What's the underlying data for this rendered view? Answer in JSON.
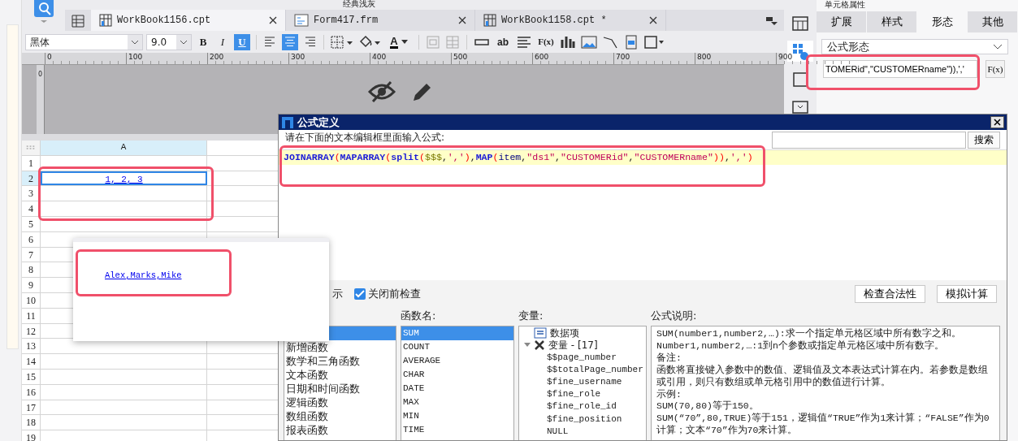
{
  "top_bar": {
    "theme_label": "经典浅灰"
  },
  "tabs": [
    {
      "label": "WorkBook1156.cpt",
      "kind": "report",
      "selected": true
    },
    {
      "label": "Form417.frm",
      "kind": "form",
      "selected": false
    },
    {
      "label": "WorkBook1158.cpt *",
      "kind": "report",
      "selected": false
    }
  ],
  "format_toolbar": {
    "font": "黑体",
    "size": "9.0",
    "style_buttons": [
      {
        "label": "B",
        "on": false
      },
      {
        "label": "I",
        "on": false
      },
      {
        "label": "U",
        "on": true
      }
    ],
    "align_buttons": [
      {
        "kind": "left",
        "selected": false
      },
      {
        "kind": "center",
        "selected": true
      },
      {
        "kind": "right",
        "selected": false
      }
    ],
    "font_color_label": "A",
    "insert_tools": [
      {
        "kind": "field"
      },
      {
        "kind": "text",
        "label": "ab"
      },
      {
        "kind": "lines"
      },
      {
        "kind": "formula",
        "label": "F(x)"
      },
      {
        "kind": "chart"
      },
      {
        "kind": "image"
      },
      {
        "kind": "slash"
      },
      {
        "kind": "doc"
      },
      {
        "kind": "border"
      }
    ]
  },
  "ruler": {
    "ticks": [
      "0",
      "100",
      "200",
      "300",
      "400",
      "500",
      "600",
      "700",
      "800",
      "900"
    ],
    "vertical_tick": "0"
  },
  "sheet": {
    "columns": [
      "A"
    ],
    "rows": [
      {
        "label": "1",
        "selected": false
      },
      {
        "label": "2",
        "selected": true,
        "value": "1, 2, 3"
      },
      {
        "label": "3",
        "selected": false
      },
      {
        "label": "4",
        "selected": false
      },
      {
        "label": "5",
        "selected": false
      },
      {
        "label": "6",
        "selected": false
      },
      {
        "label": "7",
        "selected": false
      },
      {
        "label": "8",
        "selected": false
      },
      {
        "label": "9",
        "selected": false
      },
      {
        "label": "10",
        "selected": false
      },
      {
        "label": "11",
        "selected": false
      },
      {
        "label": "12",
        "selected": false
      },
      {
        "label": "13",
        "selected": false
      },
      {
        "label": "14",
        "selected": false
      },
      {
        "label": "15",
        "selected": false
      },
      {
        "label": "16",
        "selected": false
      },
      {
        "label": "17",
        "selected": false
      },
      {
        "label": "18",
        "selected": false
      },
      {
        "label": "19",
        "selected": false
      }
    ]
  },
  "preview_popup": {
    "text": "Alex,Marks,Mike"
  },
  "dialog": {
    "title": "公式定义",
    "prompt": "请在下面的文本编辑框里面输入公式:",
    "search_button": "搜索",
    "formula": [
      {
        "text": "JOINARRAY",
        "kind": "func"
      },
      {
        "text": "(",
        "kind": "paren"
      },
      {
        "text": "MAPARRAY",
        "kind": "func"
      },
      {
        "text": "(",
        "kind": "paren"
      },
      {
        "text": "split",
        "kind": "func"
      },
      {
        "text": "(",
        "kind": "paren"
      },
      {
        "text": "$$$",
        "kind": "var"
      },
      {
        "text": ",",
        "kind": "punct"
      },
      {
        "text": "','",
        "kind": "string"
      },
      {
        "text": ")",
        "kind": "paren"
      },
      {
        "text": ",",
        "kind": "punct"
      },
      {
        "text": "MAP",
        "kind": "func"
      },
      {
        "text": "(",
        "kind": "paren"
      },
      {
        "text": "item",
        "kind": "ident"
      },
      {
        "text": ",",
        "kind": "punct"
      },
      {
        "text": "\"ds1\"",
        "kind": "string"
      },
      {
        "text": ",",
        "kind": "punct"
      },
      {
        "text": "\"CUSTOMERid\"",
        "kind": "string"
      },
      {
        "text": ",",
        "kind": "punct"
      },
      {
        "text": "\"CUSTOMERname\"",
        "kind": "string"
      },
      {
        "text": "))",
        "kind": "paren"
      },
      {
        "text": ",",
        "kind": "punct"
      },
      {
        "text": "','",
        "kind": "string"
      },
      {
        "text": ")",
        "kind": "paren"
      }
    ],
    "hint_label": "示",
    "check_before_close": {
      "label": "关闭前检查",
      "checked": true
    },
    "buttons": [
      "检查合法性",
      "模拟计算"
    ],
    "categories": [
      {
        "selected": true
      },
      {
        "label": "新增函数",
        "selected": false
      },
      {
        "label": "数学和三角函数",
        "selected": false
      },
      {
        "label": "文本函数",
        "selected": false
      },
      {
        "label": "日期和时间函数",
        "selected": false
      },
      {
        "label": "逻辑函数",
        "selected": false
      },
      {
        "label": "数组函数",
        "selected": false
      },
      {
        "label": "报表函数",
        "selected": false
      }
    ],
    "functions": {
      "header": "函数名:",
      "items": [
        {
          "label": "SUM",
          "selected": true
        },
        {
          "label": "COUNT",
          "selected": false
        },
        {
          "label": "AVERAGE",
          "selected": false
        },
        {
          "label": "CHAR",
          "selected": false
        },
        {
          "label": "DATE",
          "selected": false
        },
        {
          "label": "MAX",
          "selected": false
        },
        {
          "label": "MIN",
          "selected": false
        },
        {
          "label": "TIME",
          "selected": false
        }
      ]
    },
    "variables": {
      "header": "变量:",
      "items": [
        {
          "label": "数据项",
          "kind": "dataset"
        },
        {
          "label": "变量 - [17]",
          "kind": "group",
          "expanded": true,
          "children": [
            {
              "label": "$$page_number"
            },
            {
              "label": "$$totalPage_number"
            },
            {
              "label": "$fine_username"
            },
            {
              "label": "$fine_role"
            },
            {
              "label": "$fine_role_id"
            },
            {
              "label": "$fine_position"
            },
            {
              "label": "NULL"
            }
          ]
        }
      ]
    },
    "description": {
      "header": "公式说明:",
      "lines": [
        "SUM(number1,number2,…):求一个指定单元格区域中所有数字之和。",
        "Number1,number2,…:1到n个参数或指定单元格区域中所有数字。",
        "备注:",
        "函数将直接键入参数中的数值、逻辑值及文本表达式计算在内。若参数是数组或引用，则只有数组或单元格引用中的数值进行计算。",
        "示例:",
        "SUM(70,80)等于150。",
        "SUM(“70”,80,TRUE)等于151，逻辑值“TRUE”作为1来计算；“FALSE”作为0计算；文本“70”作为70来计算。"
      ]
    }
  },
  "property_panel": {
    "title": "单元格属性",
    "side_tools": [
      {
        "kind": "table",
        "selected": false
      },
      {
        "kind": "cell-info",
        "selected": true
      },
      {
        "kind": "square",
        "selected": false
      },
      {
        "kind": "widget",
        "selected": false
      }
    ],
    "tabs": [
      {
        "label": "扩展",
        "selected": false
      },
      {
        "label": "样式",
        "selected": false
      },
      {
        "label": "形态",
        "selected": true
      },
      {
        "label": "其他",
        "selected": false
      }
    ],
    "display_mode": "公式形态",
    "formula_value": "TOMERid\",\"CUSTOMERname\")),','",
    "fx_button": "F(x)"
  }
}
